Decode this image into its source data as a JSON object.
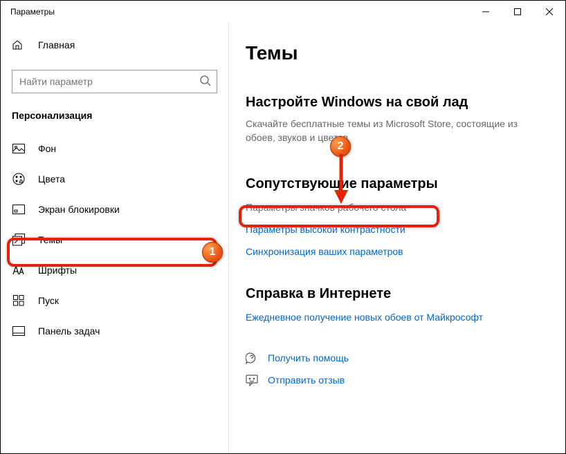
{
  "window": {
    "title": "Параметры"
  },
  "sidebar": {
    "home": "Главная",
    "search_placeholder": "Найти параметр",
    "category": "Персонализация",
    "items": [
      {
        "label": "Фон"
      },
      {
        "label": "Цвета"
      },
      {
        "label": "Экран блокировки"
      },
      {
        "label": "Темы"
      },
      {
        "label": "Шрифты"
      },
      {
        "label": "Пуск"
      },
      {
        "label": "Панель задач"
      }
    ]
  },
  "main": {
    "title": "Темы",
    "customize_heading": "Настройте Windows на свой лад",
    "customize_sub": "Скачайте бесплатные темы из Microsoft Store, состоящие из обоев, звуков и цветов",
    "related_heading": "Сопутствующие параметры",
    "related_links": [
      "Параметры значков рабочего стола",
      "Параметры высокой контрастности",
      "Синхронизация ваших параметров"
    ],
    "help_heading": "Справка в Интернете",
    "help_link": "Ежедневное получение новых обоев от Майкрософт",
    "get_help": "Получить помощь",
    "feedback": "Отправить отзыв"
  },
  "annotations": {
    "badge1": "1",
    "badge2": "2"
  }
}
